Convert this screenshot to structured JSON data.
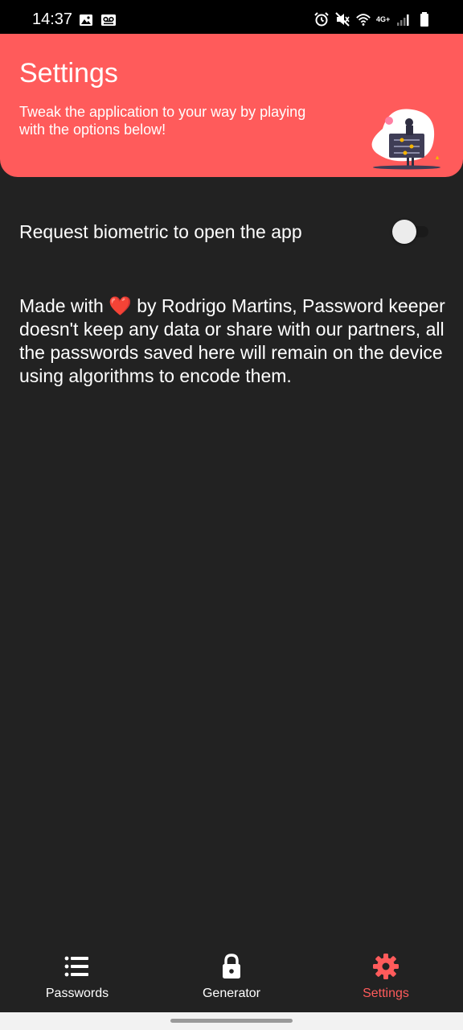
{
  "status_bar": {
    "time": "14:37",
    "network_label": "4G+",
    "icons_left": [
      "image-icon",
      "voicemail-icon"
    ],
    "icons_right": [
      "alarm-icon",
      "mute-icon",
      "wifi-icon",
      "signal-icon",
      "battery-icon"
    ]
  },
  "header": {
    "title": "Settings",
    "subtitle": "Tweak the application to your way by playing with the options below!",
    "background_color": "#ff5b5b"
  },
  "settings": {
    "biometric_label": "Request biometric to open the app",
    "biometric_enabled": false
  },
  "about": {
    "prefix": "Made with",
    "heart": "❤️",
    "text": "by Rodrigo Martins, Password keeper doesn't keep any data or share with our partners, all the passwords saved here will remain on the device using algorithms to encode them."
  },
  "nav": {
    "items": [
      {
        "label": "Passwords",
        "icon": "list-icon"
      },
      {
        "label": "Generator",
        "icon": "lock-icon"
      },
      {
        "label": "Settings",
        "icon": "gear-icon"
      }
    ],
    "active": "Settings",
    "active_color": "#ff5b5b"
  }
}
